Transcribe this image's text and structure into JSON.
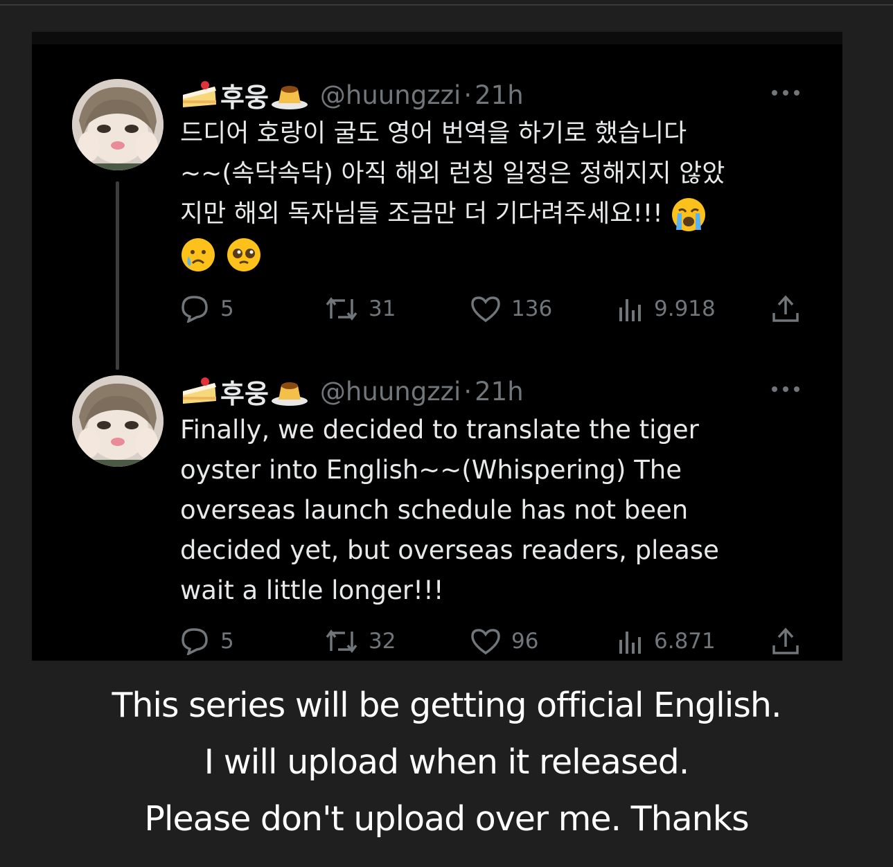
{
  "tweets": [
    {
      "display_name": "후웅",
      "handle": "@huungzzi",
      "separator": "·",
      "time": "21h",
      "text": "드디어 호랑이 굴도 영어 번역을 하기로 했습니다\n~~(속닥속닥) 아직 해외 런칭 일정은 정해지지 않았\n지만 해외 독자님들 조금만 더 기다려주세요!!!",
      "emojis": [
        "loudly-crying-face",
        "crying-face",
        "pleading-face"
      ],
      "replies": "5",
      "retweets": "31",
      "likes": "136",
      "views": "9.918"
    },
    {
      "display_name": "후웅",
      "handle": "@huungzzi",
      "separator": "·",
      "time": "21h",
      "text": "Finally, we decided to translate the tiger\noyster into English~~(Whispering) The\noverseas launch schedule has not been\ndecided yet, but overseas readers, please\nwait a little longer!!!",
      "replies": "5",
      "retweets": "32",
      "likes": "96",
      "views": "6.871"
    }
  ],
  "name_icons": [
    "shortcake-icon",
    "custard-pudding-icon"
  ],
  "caption": {
    "line1": "This series will be getting official English.",
    "line2": "I will upload when it released.",
    "line3": "Please don't upload over me. Thanks"
  },
  "colors": {
    "background": "#1f1f1f",
    "panel": "#000000",
    "text": "#e7e9ea",
    "muted": "#71767b",
    "caption": "#ffffff"
  }
}
